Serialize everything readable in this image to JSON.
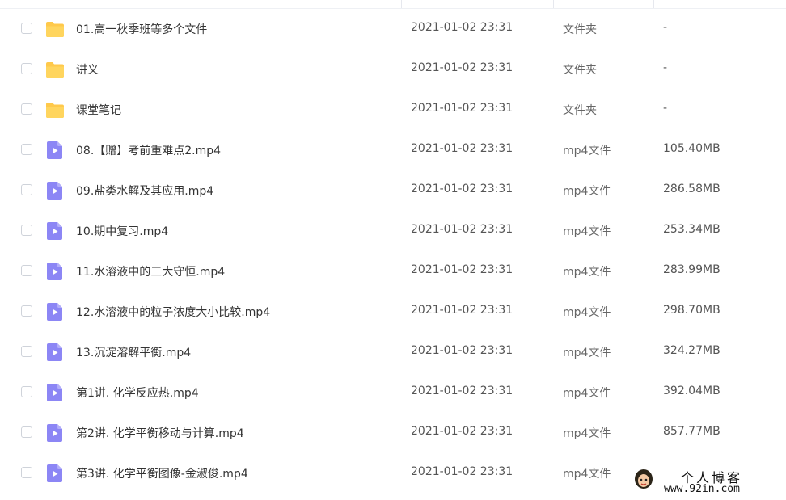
{
  "files": [
    {
      "kind": "folder",
      "name": "01.高一秋季班等多个文件",
      "date": "2021-01-02 23:31",
      "type": "文件夹",
      "size": "-"
    },
    {
      "kind": "folder",
      "name": "讲义",
      "date": "2021-01-02 23:31",
      "type": "文件夹",
      "size": "-"
    },
    {
      "kind": "folder",
      "name": "课堂笔记",
      "date": "2021-01-02 23:31",
      "type": "文件夹",
      "size": "-"
    },
    {
      "kind": "video",
      "name": "08.【赠】考前重难点2.mp4",
      "date": "2021-01-02 23:31",
      "type": "mp4文件",
      "size": "105.40MB"
    },
    {
      "kind": "video",
      "name": "09.盐类水解及其应用.mp4",
      "date": "2021-01-02 23:31",
      "type": "mp4文件",
      "size": "286.58MB"
    },
    {
      "kind": "video",
      "name": "10.期中复习.mp4",
      "date": "2021-01-02 23:31",
      "type": "mp4文件",
      "size": "253.34MB"
    },
    {
      "kind": "video",
      "name": "11.水溶液中的三大守恒.mp4",
      "date": "2021-01-02 23:31",
      "type": "mp4文件",
      "size": "283.99MB"
    },
    {
      "kind": "video",
      "name": "12.水溶液中的粒子浓度大小比较.mp4",
      "date": "2021-01-02 23:31",
      "type": "mp4文件",
      "size": "298.70MB"
    },
    {
      "kind": "video",
      "name": "13.沉淀溶解平衡.mp4",
      "date": "2021-01-02 23:31",
      "type": "mp4文件",
      "size": "324.27MB"
    },
    {
      "kind": "video",
      "name": "第1讲. 化学反应热.mp4",
      "date": "2021-01-02 23:31",
      "type": "mp4文件",
      "size": "392.04MB"
    },
    {
      "kind": "video",
      "name": "第2讲. 化学平衡移动与计算.mp4",
      "date": "2021-01-02 23:31",
      "type": "mp4文件",
      "size": "857.77MB"
    },
    {
      "kind": "video",
      "name": "第3讲. 化学平衡图像-金淑俊.mp4",
      "date": "2021-01-02 23:31",
      "type": "mp4文件",
      "size": ""
    }
  ],
  "watermark": {
    "title": "个人博客",
    "url": "www.92in.com"
  },
  "colors": {
    "folder": "#FFC94B",
    "video": "#8C86F5",
    "checkbox_border": "#CFD3DA"
  },
  "icons": {
    "folder": "folder-icon",
    "video": "video-file-icon",
    "checkbox": "checkbox"
  }
}
